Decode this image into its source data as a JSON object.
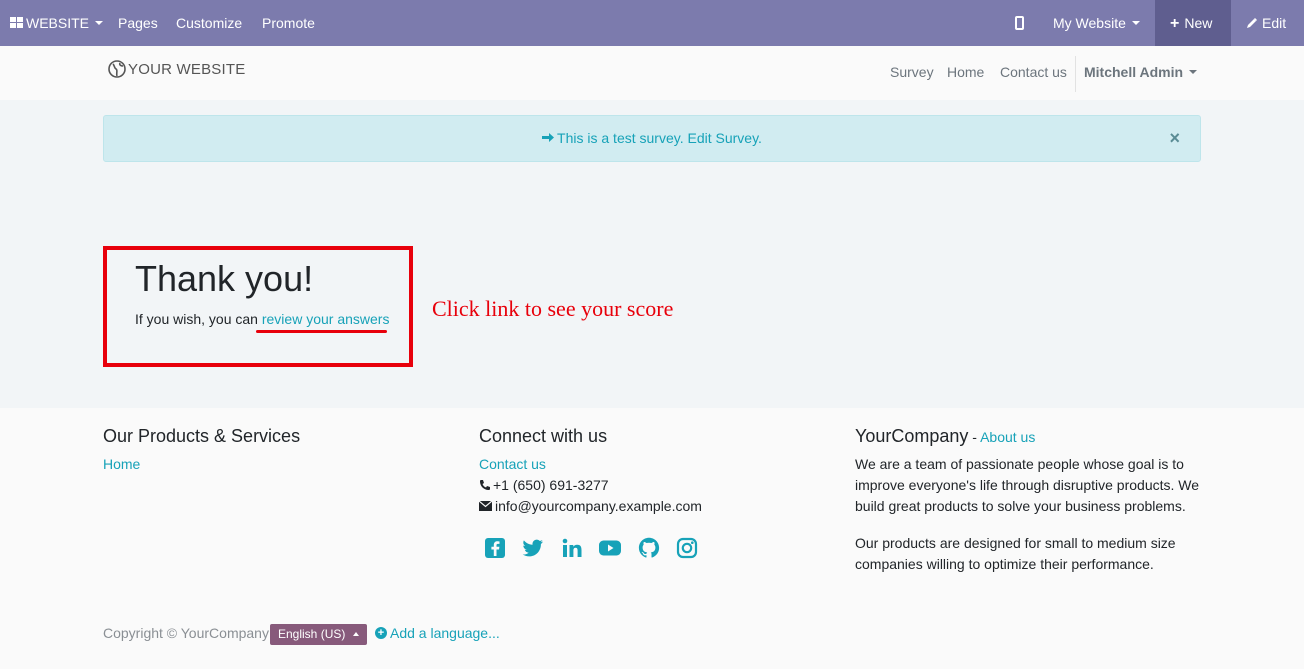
{
  "adminbar": {
    "website_menu": "WEBSITE",
    "pages": "Pages",
    "customize": "Customize",
    "promote": "Promote",
    "my_website": "My Website",
    "new": "New",
    "edit": "Edit"
  },
  "header": {
    "logo_text": "YOUR WEBSITE",
    "nav": [
      "Survey",
      "Home",
      "Contact us"
    ],
    "user": "Mitchell Admin"
  },
  "alert": {
    "message": "This is a test survey. Edit Survey.",
    "close": "×"
  },
  "thanks": {
    "title": "Thank you!",
    "prefix": "If you wish, you can ",
    "link": "review your answers"
  },
  "annotation": "Click link to see your score",
  "footer": {
    "col1": {
      "heading": "Our Products & Services",
      "links": [
        "Home"
      ]
    },
    "col2": {
      "heading": "Connect with us",
      "contact_link": "Contact us",
      "phone": "+1 (650) 691-3277",
      "email": "info@yourcompany.example.com",
      "social": [
        "facebook-icon",
        "twitter-icon",
        "linkedin-icon",
        "youtube-icon",
        "github-icon",
        "instagram-icon"
      ]
    },
    "col3": {
      "heading": "YourCompany",
      "heading_sep": " - ",
      "about_link": "About us",
      "para1": "We are a team of passionate people whose goal is to improve everyone's life through disruptive products. We build great products to solve your business problems.",
      "para2": "Our products are designed for small to medium size companies willing to optimize their performance."
    },
    "copyright": "Copyright © YourCompany",
    "language": "English (US)",
    "add_language": "Add a language..."
  },
  "colors": {
    "adminbar": "#7c7bad",
    "accent": "#17a2b8",
    "annotation_red": "#e8000b",
    "language_button": "#875a7b"
  }
}
